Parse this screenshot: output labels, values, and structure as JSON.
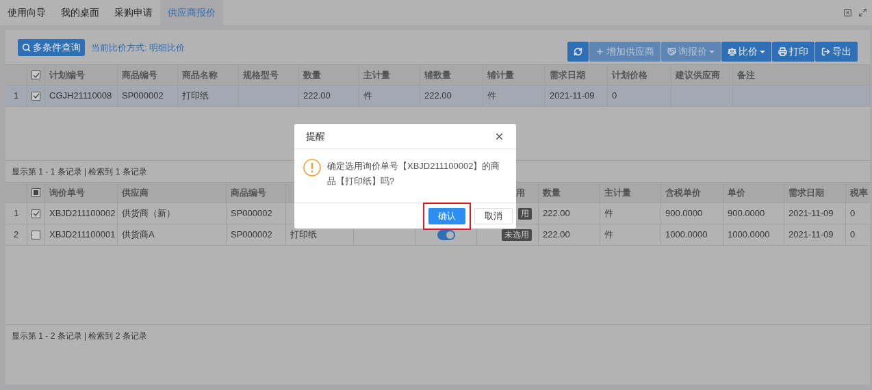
{
  "tabs": [
    {
      "label": "使用向导",
      "selected": false
    },
    {
      "label": "我的桌面",
      "selected": false
    },
    {
      "label": "采购申请",
      "selected": false
    },
    {
      "label": "供应商报价",
      "selected": true
    }
  ],
  "toolbar": {
    "query_button": "多条件查询",
    "compare_mode": "当前比价方式: 明细比价",
    "buttons": [
      {
        "disabled": false
      },
      {
        "label": "增加供应商",
        "disabled": true
      },
      {
        "label": "询报价",
        "disabled": true,
        "caret": true
      },
      {
        "label": "比价",
        "disabled": false,
        "caret": true
      },
      {
        "label": "打印",
        "disabled": false
      },
      {
        "label": "导出",
        "disabled": false
      }
    ]
  },
  "plan_table": {
    "header_checked": true,
    "columns": [
      "计划编号",
      "商品编号",
      "商品名称",
      "规格型号",
      "数量",
      "主计量",
      "辅数量",
      "辅计量",
      "需求日期",
      "计划价格",
      "建议供应商",
      "备注"
    ],
    "rows": [
      {
        "no": "1",
        "checked": true,
        "selected": true,
        "cells": [
          "CGJH21110008",
          "SP000002",
          "打印纸",
          null,
          "222.00",
          "件",
          "222.00",
          "件",
          "2021-11-09",
          "0",
          null,
          null
        ]
      }
    ],
    "pager": "显示第 1 - 1 条记录 | 检索到 1 条记录"
  },
  "quote_table": {
    "header_indeterminate": true,
    "columns": [
      "询价单号",
      "供应商",
      "商品编号",
      null,
      null,
      null,
      "用",
      "数量",
      "主计量",
      "含税单价",
      "单价",
      "需求日期",
      "税率"
    ],
    "rows": [
      {
        "no": "1",
        "checked": true,
        "cells": [
          "XBJD211100002",
          "供货商（新）",
          "SP000002",
          null,
          null,
          null,
          "用",
          "222.00",
          "件",
          "900.0000",
          "900.0000",
          "2021-11-09",
          "0"
        ]
      },
      {
        "no": "2",
        "checked": false,
        "toggle_on": true,
        "cells": [
          "XBJD211100001",
          "供货商A",
          "SP000002",
          "打印纸",
          null,
          null,
          "未选用",
          "222.00",
          "件",
          "1000.0000",
          "1000.0000",
          "2021-11-09",
          "0"
        ]
      }
    ],
    "pager": "显示第 1 - 2 条记录 | 检索到 2 条记录"
  },
  "dialog": {
    "title": "提醒",
    "message": "确定选用询价单号【XBJD211100002】的商品【打印纸】吗?",
    "buttons": [
      {
        "label": "确认",
        "kind": "primary",
        "highlighted": true
      },
      {
        "label": "取消",
        "kind": "default",
        "highlighted": false
      }
    ]
  }
}
